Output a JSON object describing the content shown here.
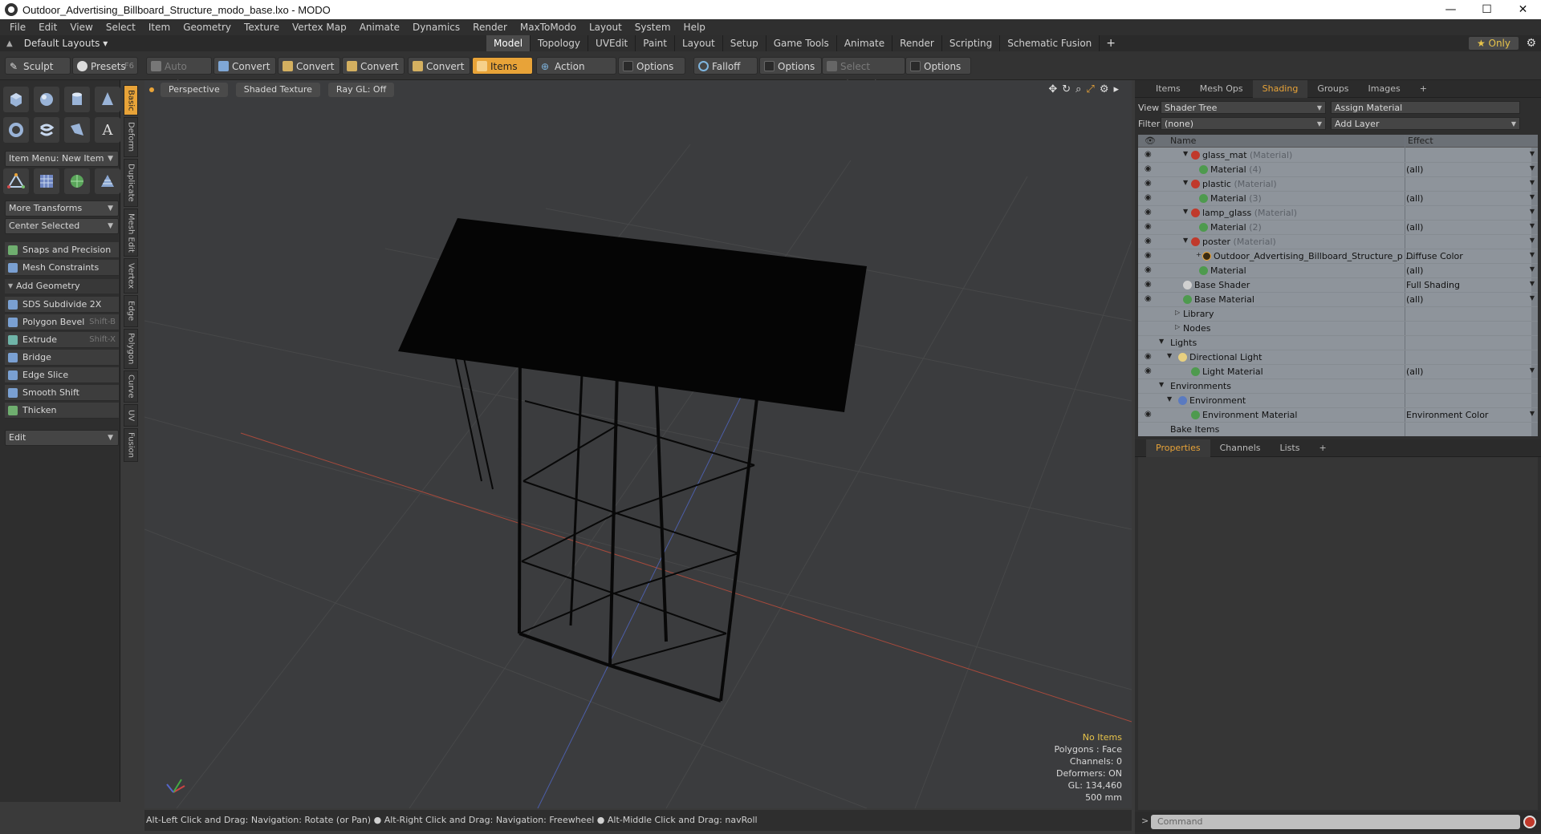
{
  "window": {
    "title": "Outdoor_Advertising_Billboard_Structure_modo_base.lxo - MODO",
    "minimize": "—",
    "maximize": "☐",
    "close": "✕"
  },
  "menu": [
    "File",
    "Edit",
    "View",
    "Select",
    "Item",
    "Geometry",
    "Texture",
    "Vertex Map",
    "Animate",
    "Dynamics",
    "Render",
    "MaxToModo",
    "Layout",
    "System",
    "Help"
  ],
  "layoutbar": {
    "layouts_label": "Default Layouts ▾",
    "tabs": [
      "Model",
      "Topology",
      "UVEdit",
      "Paint",
      "Layout",
      "Setup",
      "Game Tools",
      "Animate",
      "Render",
      "Scripting",
      "Schematic Fusion"
    ],
    "active_tab": "Model",
    "plus": "+",
    "only_label": "★  Only"
  },
  "toolbar": {
    "sculpt": "Sculpt",
    "presets": "Presets",
    "presets_key": "F6",
    "auto_select": "Auto Select",
    "convert1": "Convert",
    "convert2": "Convert",
    "convert3": "Convert",
    "convert4": "Convert",
    "items": "Items",
    "action_center": "Action Center",
    "options1": "Options",
    "falloff": "Falloff",
    "options2": "Options",
    "select_through": "Select Through",
    "options3": "Options"
  },
  "leftpanel": {
    "item_menu": "Item Menu: New Item",
    "more_transforms": "More Transforms",
    "center_selected": "Center Selected",
    "snaps": "Snaps and Precision",
    "mesh_constraints": "Mesh Constraints",
    "add_geometry": "Add Geometry",
    "tools": [
      {
        "label": "SDS Subdivide 2X",
        "key": ""
      },
      {
        "label": "Polygon Bevel",
        "key": "Shift-B"
      },
      {
        "label": "Extrude",
        "key": "Shift-X"
      },
      {
        "label": "Bridge",
        "key": ""
      },
      {
        "label": "Edge Slice",
        "key": ""
      },
      {
        "label": "Smooth Shift",
        "key": ""
      },
      {
        "label": "Thicken",
        "key": ""
      }
    ],
    "edit": "Edit",
    "vtabs": [
      "Basic",
      "Deform",
      "Duplicate",
      "Mesh Edit",
      "Vertex",
      "Edge",
      "Polygon",
      "Curve",
      "UV",
      "Fusion"
    ]
  },
  "viewport": {
    "perspective": "Perspective",
    "shading": "Shaded Texture",
    "raygl": "Ray GL: Off",
    "stats": {
      "items": "No Items",
      "polygons": "Polygons : Face",
      "channels": "Channels: 0",
      "deformers": "Deformers: ON",
      "gl": "GL: 134,460",
      "size": "500 mm"
    }
  },
  "hint": "Alt-Left Click and Drag: Navigation: Rotate (or Pan) ● Alt-Right Click and Drag: Navigation: Freewheel ● Alt-Middle Click and Drag: navRoll",
  "rightpanel": {
    "tabs": [
      "Items",
      "Mesh Ops",
      "Shading",
      "Groups",
      "Images",
      "+"
    ],
    "active_tab": "Shading",
    "view_label": "View",
    "view_value": "Shader Tree",
    "assign_material": "Assign Material",
    "filter_label": "Filter",
    "filter_value": "(none)",
    "add_layer": "Add Layer",
    "col_name": "Name",
    "col_effect": "Effect",
    "rows": [
      {
        "name": "glass_mat",
        "sub": "(Material)",
        "effect": ""
      },
      {
        "name": "Material",
        "sub": "(4)",
        "effect": "(all)"
      },
      {
        "name": "plastic",
        "sub": "(Material)",
        "effect": ""
      },
      {
        "name": "Material",
        "sub": "(3)",
        "effect": "(all)"
      },
      {
        "name": "lamp_glass",
        "sub": "(Material)",
        "effect": ""
      },
      {
        "name": "Material",
        "sub": "(2)",
        "effect": "(all)"
      },
      {
        "name": "poster",
        "sub": "(Material)",
        "effect": ""
      },
      {
        "name": "Outdoor_Advertising_Billboard_Structure_p ...",
        "sub": "",
        "effect": "Diffuse Color"
      },
      {
        "name": "Material",
        "sub": "",
        "effect": "(all)"
      },
      {
        "name": "Base Shader",
        "sub": "",
        "effect": "Full Shading"
      },
      {
        "name": "Base Material",
        "sub": "",
        "effect": "(all)"
      },
      {
        "name": "Library",
        "sub": "",
        "effect": ""
      },
      {
        "name": "Nodes",
        "sub": "",
        "effect": ""
      },
      {
        "name": "Lights",
        "sub": "",
        "effect": ""
      },
      {
        "name": "Directional Light",
        "sub": "",
        "effect": ""
      },
      {
        "name": "Light Material",
        "sub": "",
        "effect": "(all)"
      },
      {
        "name": "Environments",
        "sub": "",
        "effect": ""
      },
      {
        "name": "Environment",
        "sub": "",
        "effect": ""
      },
      {
        "name": "Environment Material",
        "sub": "",
        "effect": "Environment Color"
      },
      {
        "name": "Bake Items",
        "sub": "",
        "effect": ""
      }
    ],
    "props_tabs": [
      "Properties",
      "Channels",
      "Lists",
      "+"
    ],
    "props_active": "Properties",
    "command_placeholder": "Command",
    "prompt": ">"
  }
}
